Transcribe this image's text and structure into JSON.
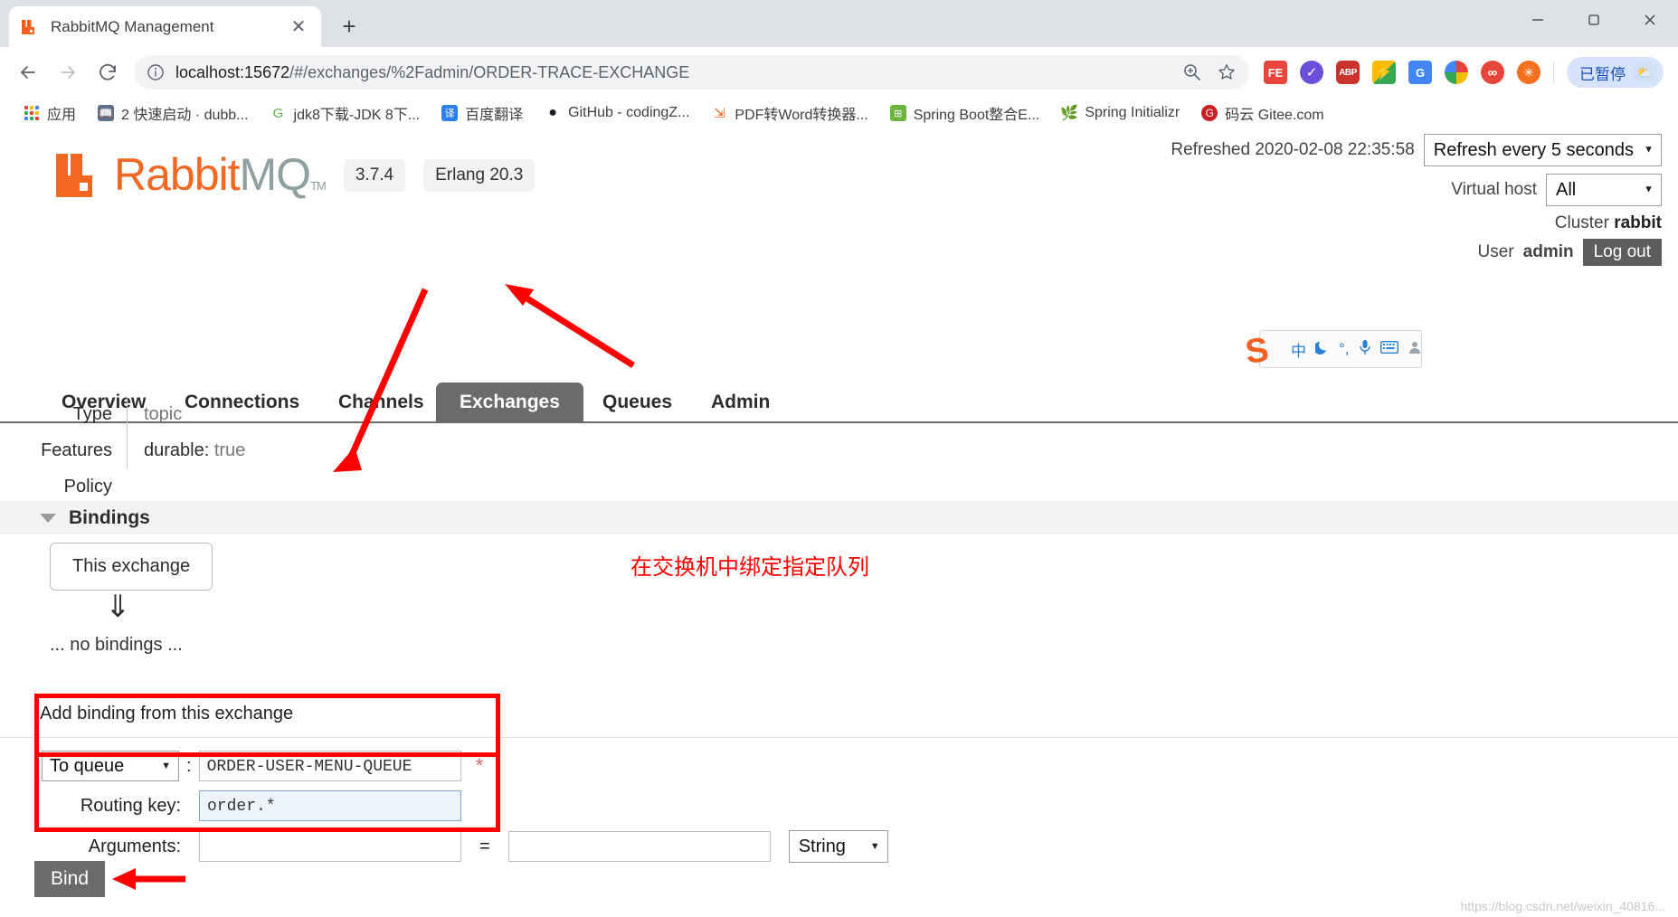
{
  "browser": {
    "tab": {
      "title": "RabbitMQ Management",
      "favicon_icon": "rabbitmq-icon",
      "close_icon": "close-icon"
    },
    "new_tab_label": "+",
    "window_controls": {
      "minimize": "minimize-icon",
      "maximize": "maximize-icon",
      "close": "close-icon"
    },
    "nav": {
      "back": "back-arrow-icon",
      "forward": "forward-arrow-icon",
      "reload": "reload-icon"
    },
    "omnibox": {
      "info_icon": "info-circle-icon",
      "host": "localhost:15672",
      "path": "/#/exchanges/%2Fadmin/ORDER-TRACE-EXCHANGE",
      "zoom_icon": "zoom-in-icon",
      "bookmark_icon": "star-icon"
    },
    "extensions": [
      {
        "name": "fe-extension-icon",
        "label": "FE"
      },
      {
        "name": "check-extension-icon",
        "label": "✓"
      },
      {
        "name": "adblock-plus-icon",
        "label": "ABP"
      },
      {
        "name": "google-drive-extension-icon",
        "label": "⚡"
      },
      {
        "name": "google-translate-extension-icon",
        "label": "G"
      },
      {
        "name": "google-photos-extension-icon",
        "label": ""
      },
      {
        "name": "infinity-extension-icon",
        "label": "∞"
      },
      {
        "name": "orange-extension-icon",
        "label": "✳"
      }
    ],
    "profile": {
      "paused_label": "已暂停",
      "avatar_icon": "weather-avatar-icon"
    },
    "bookmarks": [
      {
        "label": "应用",
        "icon": "apps-grid-icon"
      },
      {
        "label": "2 快速启动 · dubb...",
        "icon": "book-icon"
      },
      {
        "label": "jdk8下载-JDK 8下...",
        "icon": "jdk-icon"
      },
      {
        "label": "百度翻译",
        "icon": "baidu-translate-icon"
      },
      {
        "label": "GitHub - codingZ...",
        "icon": "github-icon"
      },
      {
        "label": "PDF转Word转换器...",
        "icon": "pdf-icon"
      },
      {
        "label": "Spring Boot整合E...",
        "icon": "spring-boot-icon"
      },
      {
        "label": "Spring Initializr",
        "icon": "spring-leaf-icon"
      },
      {
        "label": "码云 Gitee.com",
        "icon": "gitee-icon"
      }
    ]
  },
  "rabbitmq": {
    "logo": {
      "name": "RabbitMQ",
      "part_a": "Rabbit",
      "part_b": "MQ",
      "tm": "TM"
    },
    "version_badge": "3.7.4",
    "erlang_badge": "Erlang 20.3",
    "refreshed_label": "Refreshed 2020-02-08 22:35:58",
    "refresh_select": {
      "value": "Refresh every 5 seconds",
      "chevron": "chevron-down-icon"
    },
    "vhost_label": "Virtual host",
    "vhost_select": {
      "value": "All",
      "chevron": "chevron-down-icon"
    },
    "cluster_label": "Cluster",
    "cluster_name": "rabbit",
    "user_label": "User",
    "user_name": "admin",
    "logout_label": "Log out",
    "tabs": [
      {
        "label": "Overview",
        "active": false
      },
      {
        "label": "Connections",
        "active": false
      },
      {
        "label": "Channels",
        "active": false
      },
      {
        "label": "Exchanges",
        "active": true
      },
      {
        "label": "Queues",
        "active": false
      },
      {
        "label": "Admin",
        "active": false
      }
    ],
    "details": [
      {
        "label": "Type",
        "value": "topic",
        "key": "",
        "val": ""
      },
      {
        "label": "Features",
        "key": "durable:",
        "val": "true"
      },
      {
        "label": "Policy",
        "key": "",
        "val": ""
      }
    ],
    "bindings_section": {
      "title": "Bindings",
      "caret_icon": "caret-down-icon",
      "this_exchange_label": "This exchange",
      "down_arrow_icon": "double-down-arrow-icon",
      "empty_label": "... no bindings ..."
    },
    "add_binding": {
      "title": "Add binding from this exchange",
      "to_queue_select": {
        "value": "To queue",
        "chevron": "chevron-down-icon"
      },
      "colon": ":",
      "queue_value": "ORDER-USER-MENU-QUEUE",
      "required_mark": "*",
      "routing_key_label": "Routing key:",
      "routing_key_value": "order.*",
      "arguments_label": "Arguments:",
      "arguments_key": "",
      "equals": "=",
      "arguments_value": "",
      "type_select": {
        "value": "String",
        "chevron": "chevron-down-icon"
      },
      "bind_button": "Bind"
    }
  },
  "ime": {
    "logo_label": "S",
    "icons": [
      {
        "name": "chinese-mode-icon",
        "glyph": "中"
      },
      {
        "name": "moon-icon",
        "glyph": "🌙"
      },
      {
        "name": "punctuation-icon",
        "glyph": "°,"
      },
      {
        "name": "microphone-icon",
        "glyph": "🎤"
      },
      {
        "name": "keyboard-icon",
        "glyph": "⌨"
      },
      {
        "name": "user-icon",
        "glyph": "👤"
      }
    ]
  },
  "annotations": {
    "chinese_note": "在交换机中绑定指定队列",
    "highlight_color": "#ff0000"
  },
  "watermark": "https://blog.csdn.net/weixin_40816..."
}
